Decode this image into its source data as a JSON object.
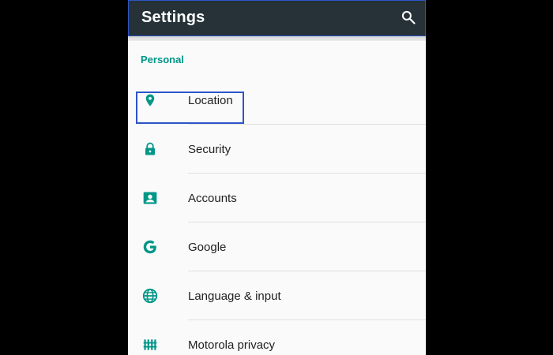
{
  "appbar": {
    "title": "Settings",
    "search_icon": "search-icon"
  },
  "section": {
    "header": "Personal"
  },
  "items": [
    {
      "label": "Location",
      "icon": "location-pin-icon"
    },
    {
      "label": "Security",
      "icon": "lock-icon"
    },
    {
      "label": "Accounts",
      "icon": "account-box-icon"
    },
    {
      "label": "Google",
      "icon": "google-g-icon"
    },
    {
      "label": "Language & input",
      "icon": "globe-icon"
    },
    {
      "label": "Motorola privacy",
      "icon": "privacy-icon"
    }
  ],
  "colors": {
    "appbar_bg": "#263238",
    "accent": "#009688",
    "highlight_border": "#2d55c8",
    "text_primary": "#212121"
  }
}
